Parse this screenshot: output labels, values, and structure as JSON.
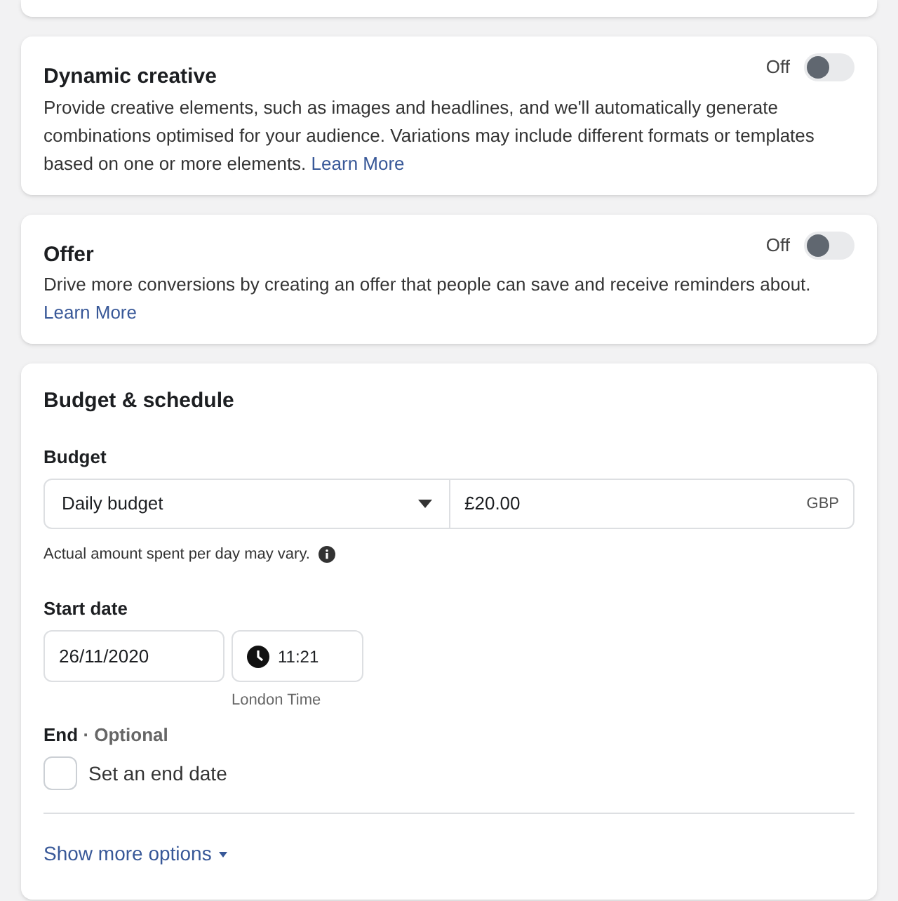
{
  "sections": [
    {
      "title": "Dynamic creative",
      "toggle_label": "Off",
      "on": false,
      "description": "Provide creative elements, such as images and headlines, and we'll automatically generate combinations optimised for your audience. Variations may include different formats or templates based on one or more elements.",
      "link": "Learn More"
    },
    {
      "title": "Offer",
      "toggle_label": "Off",
      "on": false,
      "description": "Drive more conversions by creating an offer that people can save and receive reminders about.",
      "link": "Learn More"
    }
  ],
  "budget_schedule": {
    "title": "Budget & schedule",
    "budget_label": "Budget",
    "budget_type": "Daily budget",
    "amount": "£20.00",
    "currency": "GBP",
    "note": "Actual amount spent per day may vary.",
    "start_label": "Start date",
    "start_date": "26/11/2020",
    "start_time": "11:21",
    "timezone": "London Time",
    "end_label": "End",
    "end_hint": "· Optional",
    "end_checkbox": {
      "label": "Set an end date",
      "checked": false
    },
    "more_link": "Show more options"
  }
}
